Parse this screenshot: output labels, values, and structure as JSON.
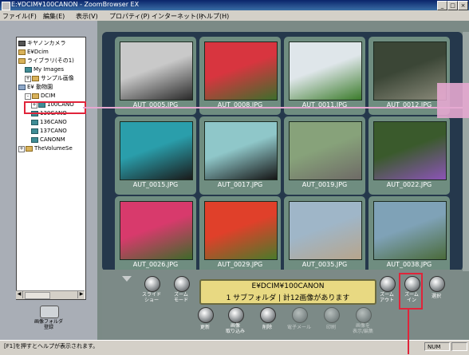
{
  "window": {
    "title": "E:¥DCIM¥100CANON - ZoomBrowser EX",
    "min": "_",
    "max": "□",
    "close": "×"
  },
  "menu": [
    "ファイル(F)",
    "編集(E)",
    "表示(V)",
    "プロパティ(P)",
    "インターネット(I)",
    "ヘルプ(H)"
  ],
  "tree": [
    {
      "label": "キヤノンカメラ",
      "icon": "cam",
      "indent": 0
    },
    {
      "label": "E¥Dcim",
      "icon": "folder",
      "indent": 0
    },
    {
      "label": "ライブラリ(その1)",
      "icon": "folder",
      "indent": 0
    },
    {
      "label": "My Images",
      "icon": "teal",
      "indent": 1
    },
    {
      "label": "サンプル画像",
      "icon": "folder",
      "indent": 1,
      "exp": "+"
    },
    {
      "label": "E¥ 動物園",
      "icon": "pc",
      "indent": 0
    },
    {
      "label": "DCIM",
      "icon": "folder",
      "indent": 1,
      "exp": "-"
    },
    {
      "label": "100CANO",
      "icon": "teal",
      "indent": 2,
      "exp": "+"
    },
    {
      "label": "130CANO",
      "icon": "teal",
      "indent": 2
    },
    {
      "label": "136CANO",
      "icon": "teal",
      "indent": 2
    },
    {
      "label": "137CANO",
      "icon": "teal",
      "indent": 2
    },
    {
      "label": "CANONM",
      "icon": "teal",
      "indent": 2
    },
    {
      "label": "TheVolumeSe",
      "icon": "folder",
      "indent": 0,
      "exp": "+"
    }
  ],
  "left_button": {
    "label": "画像フォルダ\n登録"
  },
  "thumbnails": [
    {
      "label": "AUT_0005.JPG",
      "c1": "#c9c9c9",
      "c2": "#2a2a2a"
    },
    {
      "label": "AUT_0008.JPG",
      "c1": "#d8353f",
      "c2": "#3d6e2c"
    },
    {
      "label": "AUT_0011.JPG",
      "c1": "#dfe6ea",
      "c2": "#3c7c2c"
    },
    {
      "label": "AUT_0012.JPG",
      "c1": "#3b4636",
      "c2": "#8a8a7a"
    },
    {
      "label": "AUT_0015.JPG",
      "c1": "#2a9eab",
      "c2": "#1a1a1a"
    },
    {
      "label": "AUT_0017.JPG",
      "c1": "#8fc7c9",
      "c2": "#151515"
    },
    {
      "label": "AUT_0019.JPG",
      "c1": "#87a27a",
      "c2": "#6e6a66"
    },
    {
      "label": "AUT_0022.JPG",
      "c1": "#3a5a2c",
      "c2": "#8c54b7"
    },
    {
      "label": "AUT_0026.JPG",
      "c1": "#d83a6c",
      "c2": "#3e6a2a"
    },
    {
      "label": "AUT_0029.JPG",
      "c1": "#e0402a",
      "c2": "#4a7a2a"
    },
    {
      "label": "AUT_0035.JPG",
      "c1": "#9fb6c8",
      "c2": "#b7a58c"
    },
    {
      "label": "AUT_0038.JPG",
      "c1": "#7fa2b7",
      "c2": "#4a6a3a"
    }
  ],
  "info": {
    "line1": "E¥DCIM¥100CANON",
    "line2": "1 サブフォルダ | 計12画像があります"
  },
  "controls": {
    "slideshow": "スライド\nショー",
    "zoom_mode": "ズーム\nモード",
    "zoom_out": "ズーム\nアウト",
    "zoom_in": "ズーム\nイン",
    "select": "選択",
    "refresh": "更新",
    "import": "画像\n取り込み",
    "delete": "削除",
    "email": "電子メール",
    "print": "印刷",
    "more": "画像を\n表示/編集"
  },
  "status": {
    "help": "[F1]を押すとヘルプが表示されます。",
    "num": "NUM"
  },
  "accent_colors": {
    "highlight": "#e0243a",
    "pointer_line": "#e6a8d0"
  }
}
